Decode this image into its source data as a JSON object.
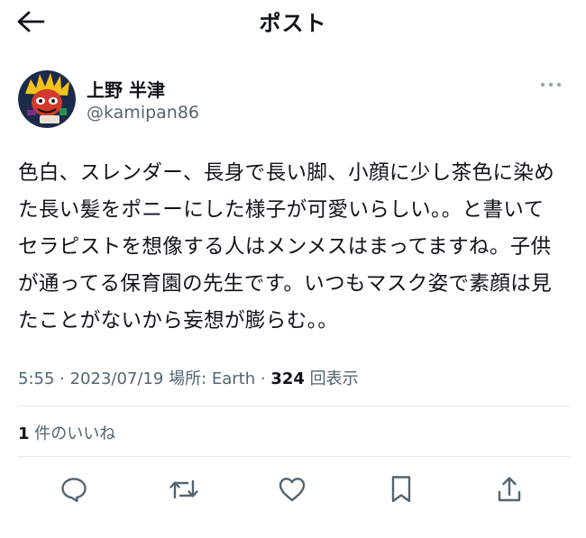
{
  "header": {
    "title": "ポスト",
    "back_icon": "arrow-left-icon"
  },
  "author": {
    "display_name": "上野 半津",
    "handle": "@kamipan86",
    "avatar_icon": "avatar-image",
    "more_icon": "more-horizontal-icon"
  },
  "post": {
    "lines": [
      "色白、スレンダー、長身で長い脚、小顔に少し茶色に染め",
      "た長い髪をポニーにした様子が可愛いらしい。。と書いて",
      "セラピストを想像する人はメンメスはまってますね。子供",
      "が通ってる保育園の先生です。いつもマスク姿で素顔は見",
      "たことがないから妄想が膨らむ。。"
    ]
  },
  "meta": {
    "time": "5:55",
    "separator": " · ",
    "date": "2023/07/19",
    "location_label": "場所: ",
    "location": "Earth",
    "views": "324",
    "views_label": " 回表示"
  },
  "likes": {
    "count": "1",
    "label": " 件のいいね"
  },
  "actions": [
    {
      "icon": "reply-icon"
    },
    {
      "icon": "repost-icon"
    },
    {
      "icon": "like-icon"
    },
    {
      "icon": "bookmark-icon"
    },
    {
      "icon": "share-icon"
    }
  ],
  "colors": {
    "text": "#0f1419",
    "secondary": "#536471",
    "divider": "#e6e9eb"
  }
}
